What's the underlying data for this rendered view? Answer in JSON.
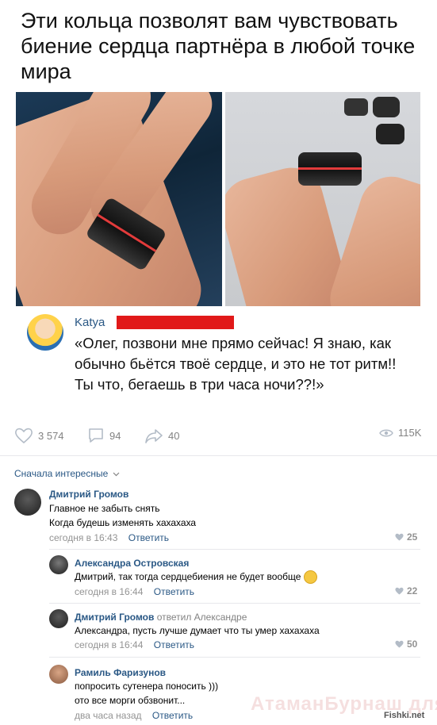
{
  "title": "Эти кольца позволят вам чувствовать биение сердца партнёра в любой точке мира",
  "quote": {
    "author": "Katya",
    "text": "«Олег, позвони мне прямо сейчас! Я знаю, как обычно бьётся твоё сердце, и это не тот ритм!! Ты что, бегаешь в три часа ночи??!»"
  },
  "stats": {
    "likes": "3 574",
    "comments": "94",
    "shares": "40",
    "views": "115K"
  },
  "sort_label": "Сначала интересные",
  "comments": [
    {
      "name": "Дмитрий Громов",
      "reply_to": "",
      "lines": [
        "Главное не забыть снять",
        "Когда будешь изменять хахахаха"
      ],
      "time": "сегодня в 16:43",
      "reply_label": "Ответить",
      "likes": "25"
    },
    {
      "name": "Александра Островская",
      "reply_to": "",
      "lines": [
        "Дмитрий, так тогда сердцебиения не будет вообще"
      ],
      "time": "сегодня в 16:44",
      "reply_label": "Ответить",
      "likes": "22"
    },
    {
      "name": "Дмитрий Громов",
      "reply_to": "ответил Александре",
      "lines": [
        "Александра, пусть лучше думает что ты умер хахахаха"
      ],
      "time": "сегодня в 16:44",
      "reply_label": "Ответить",
      "likes": "50"
    },
    {
      "name": "Рамиль Фаризунов",
      "reply_to": "",
      "lines": [
        "попросить сутенера поносить )))",
        "ото все морги обзвонит..."
      ],
      "time": "два часа назад",
      "reply_label": "Ответить",
      "likes": ""
    }
  ],
  "watermark": "АтаманБурнаш для ЯП",
  "source_mark": "Fishki.net",
  "colors": {
    "link": "#2a5885",
    "meta": "#939393",
    "accent_red": "#e11919"
  }
}
